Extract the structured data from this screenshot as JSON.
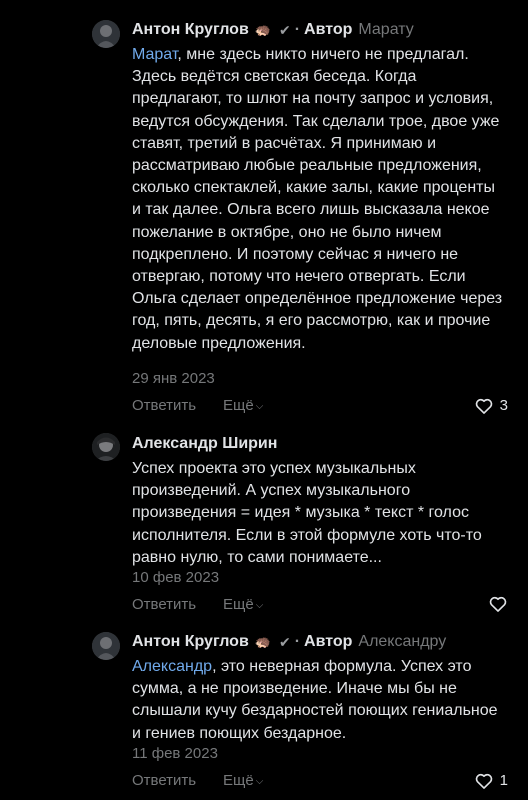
{
  "comments": [
    {
      "author": "Антон Круглов",
      "emoji": "🦔",
      "badge": "Автор",
      "separator": "·",
      "verified": "✔",
      "reply_to": "Марату",
      "mention": "Марат",
      "text": ", мне здесь никто ничего не предлагал. Здесь ведётся светская беседа. Когда предлагают, то шлют на почту запрос и условия, ведутся обсуждения. Так сделали трое, двое уже ставят, третий в расчётах. Я принимаю и рассматриваю любые реальные предложения, сколько спектаклей, какие залы, какие проценты и так далее. Ольга всего лишь высказала некое пожелание в октябре, оно не было ничем подкреплено. И поэтому сейчас я ничего не отвергаю, потому что нечего отвергать. Если Ольга сделает определённое предложение через год, пять, десять, я его рассмотрю, как и прочие деловые предложения.",
      "date": "29 янв 2023",
      "reply_label": "Ответить",
      "more_label": "Ещё",
      "likes": "3"
    },
    {
      "author": "Александр Ширин",
      "text": "Успех проекта это успех музыкальных произведений. А успех музыкального произведения = идея * музыка * текст * голос исполнителя. Если в этой формуле хоть что-то равно нулю, то сами понимаете...",
      "date": "10 фев 2023",
      "reply_label": "Ответить",
      "more_label": "Ещё"
    },
    {
      "author": "Антон Круглов",
      "emoji": "🦔",
      "badge": "Автор",
      "separator": "·",
      "verified": "✔",
      "reply_to": "Александру",
      "mention": "Александр",
      "text": ", это неверная формула. Успех это сумма, а не произведение. Иначе мы бы не слышали кучу бездарностей поющих гениальное и гениев поющих бездарное.",
      "date": "11 фев 2023",
      "reply_label": "Ответить",
      "more_label": "Ещё",
      "likes": "1"
    }
  ],
  "icons": {
    "more_chevron": "chevron-down-icon",
    "like": "heart-icon"
  },
  "colors": {
    "background": "#000000",
    "text": "#e1e3e6",
    "secondary": "#76787a",
    "mention": "#71aaeb"
  }
}
